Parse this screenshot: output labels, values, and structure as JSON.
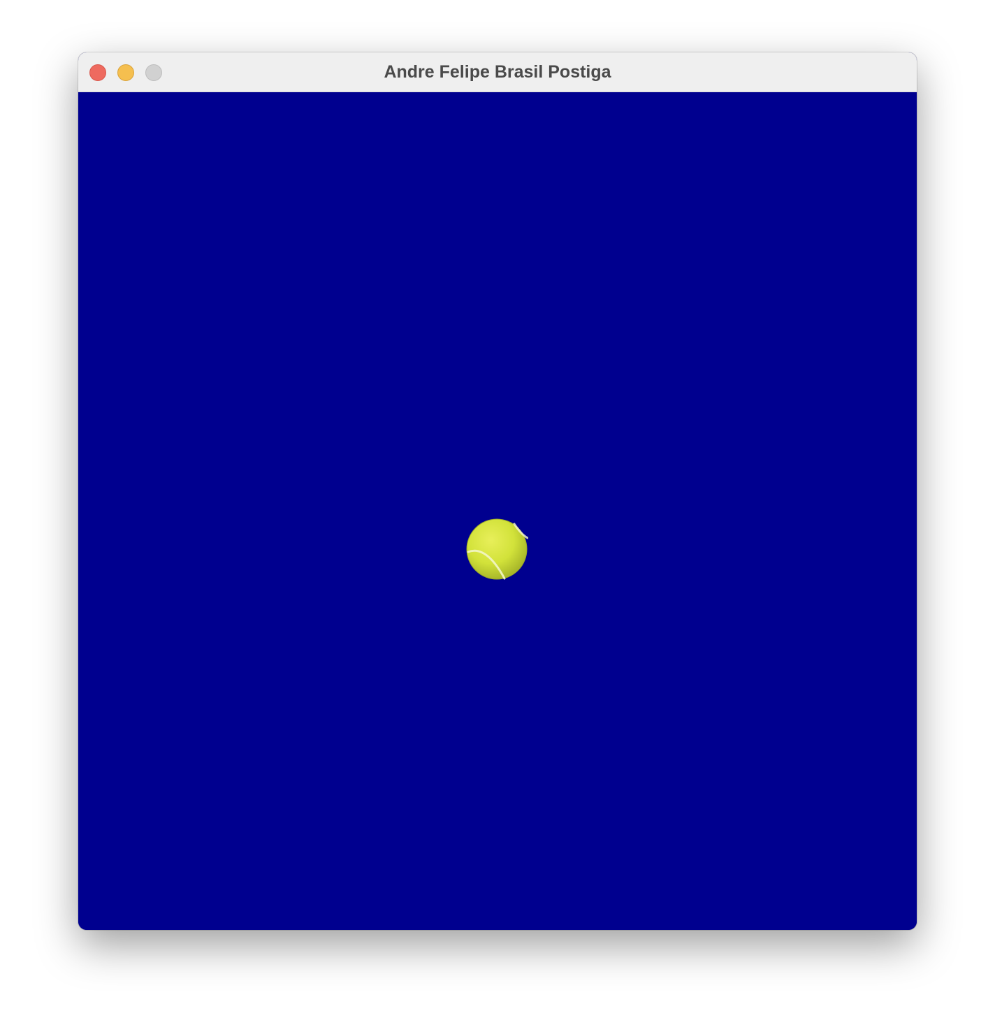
{
  "window": {
    "title": "Andre Felipe Brasil Postiga",
    "controls": [
      "close",
      "minimize",
      "zoom"
    ]
  },
  "canvas": {
    "background_color": "#00008f",
    "object": "tennis-ball-icon",
    "object_color": "#d2e23a"
  }
}
